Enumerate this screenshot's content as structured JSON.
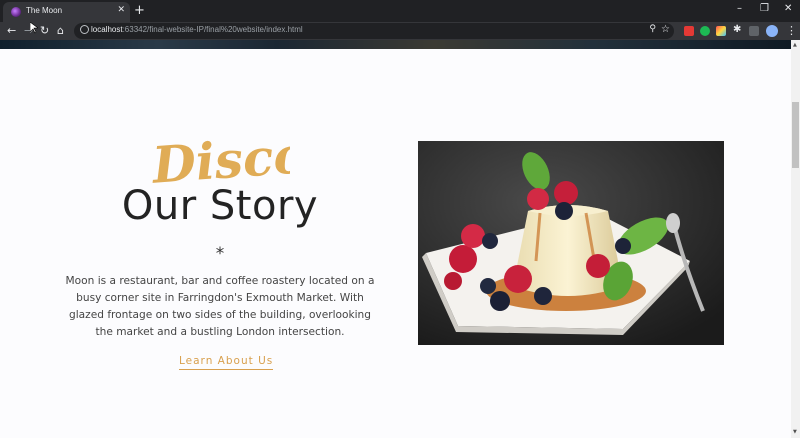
{
  "browser": {
    "tab_title": "The Moon",
    "tab_close": "✕",
    "new_tab": "+",
    "url_host": "localhost",
    "url_path": ":63342/final-website-IP/final%20website/index.html",
    "window_controls": [
      "–",
      "❐",
      "✕"
    ]
  },
  "icons": {
    "back": "←",
    "forward": "→",
    "reload": "↻",
    "home": "⌂",
    "zoom": "⚲",
    "star": "☆",
    "menu": "⋮"
  },
  "story": {
    "script_heading": "Discover",
    "heading": "Our Story",
    "divider": "*",
    "body": "Moon is a restaurant, bar and coffee roastery located on a busy corner site in Farringdon's Exmouth Market. With glazed frontage on two sides of the building, overlooking the market and a bustling London intersection.",
    "cta": "Learn About Us"
  },
  "colors": {
    "accent": "#e0ac56",
    "heading": "#232323",
    "body_text": "#444444",
    "chrome_dark": "#202124",
    "chrome_mid": "#35363a"
  }
}
